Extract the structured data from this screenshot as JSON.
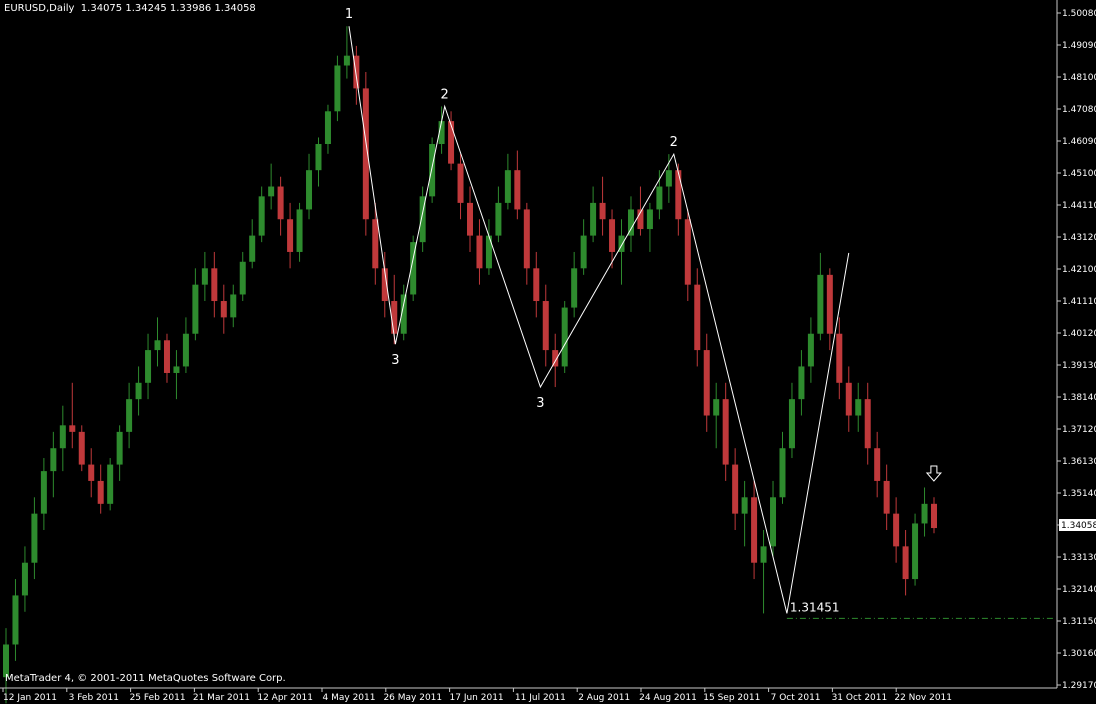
{
  "header": {
    "symbol": "EURUSD,Daily",
    "open": "1.34075",
    "high": "1.34245",
    "low": "1.33986",
    "close": "1.34058"
  },
  "copyright": "MetaTrader 4, © 2001-2011 MetaQuotes Software Corp.",
  "current_price": "1.34058",
  "colors": {
    "background": "#000000",
    "bull": "#2e8b2e",
    "bear": "#c0393b",
    "axis": "#c8c8c8",
    "grid_dash": "#2e8b2e",
    "price_tag_bg": "#ffffff",
    "price_tag_fg": "#000000"
  },
  "chart_data": {
    "type": "candlestick",
    "y_ticks": [
      "1.50080",
      "1.49090",
      "1.48100",
      "1.47080",
      "1.46090",
      "1.45100",
      "1.44110",
      "1.43120",
      "1.42100",
      "1.41110",
      "1.40120",
      "1.39130",
      "1.38140",
      "1.37120",
      "1.36130",
      "1.35140",
      "1.34058",
      "1.33130",
      "1.32140",
      "1.31150",
      "1.30160",
      "1.29170"
    ],
    "x_ticks": [
      "12 Jan 2011",
      "3 Feb 2011",
      "25 Feb 2011",
      "21 Mar 2011",
      "12 Apr 2011",
      "4 May 2011",
      "26 May 2011",
      "17 Jun 2011",
      "11 Jul 2011",
      "2 Aug 2011",
      "24 Aug 2011",
      "15 Sep 2011",
      "7 Oct 2011",
      "31 Oct 2011",
      "22 Nov 2011"
    ],
    "ylim": [
      1.2917,
      1.5008
    ],
    "zigzag": [
      {
        "date": "4 May 2011",
        "price": 1.494,
        "label": "1"
      },
      {
        "date": "20 May 2011",
        "price": 1.3968,
        "label": "3"
      },
      {
        "date": "6 Jun 2011",
        "price": 1.4695,
        "label": "2"
      },
      {
        "date": "11 Jul 2011",
        "price": 1.3837,
        "label": "3"
      },
      {
        "date": "26 Aug 2011",
        "price": 1.4549,
        "label": "2"
      },
      {
        "date": "4 Oct 2011",
        "price": 1.3145,
        "label": ""
      },
      {
        "date": "27 Oct 2011",
        "price": 1.4247,
        "label": ""
      }
    ],
    "low_marker": {
      "price": 1.31451,
      "label": "1.31451"
    },
    "arrow_marker": {
      "date": "25 Nov 2011",
      "direction": "down"
    },
    "candles_approx": [
      [
        1.295,
        1.31,
        1.287,
        1.305
      ],
      [
        1.305,
        1.325,
        1.3,
        1.32
      ],
      [
        1.32,
        1.335,
        1.315,
        1.33
      ],
      [
        1.33,
        1.35,
        1.325,
        1.345
      ],
      [
        1.345,
        1.362,
        1.34,
        1.358
      ],
      [
        1.358,
        1.37,
        1.35,
        1.365
      ],
      [
        1.365,
        1.378,
        1.358,
        1.372
      ],
      [
        1.372,
        1.385,
        1.365,
        1.37
      ],
      [
        1.37,
        1.372,
        1.358,
        1.36
      ],
      [
        1.36,
        1.365,
        1.35,
        1.355
      ],
      [
        1.355,
        1.36,
        1.345,
        1.348
      ],
      [
        1.348,
        1.362,
        1.346,
        1.36
      ],
      [
        1.36,
        1.372,
        1.355,
        1.37
      ],
      [
        1.37,
        1.385,
        1.365,
        1.38
      ],
      [
        1.38,
        1.39,
        1.375,
        1.385
      ],
      [
        1.385,
        1.4,
        1.38,
        1.395
      ],
      [
        1.395,
        1.405,
        1.39,
        1.398
      ],
      [
        1.398,
        1.4,
        1.385,
        1.388
      ],
      [
        1.388,
        1.395,
        1.38,
        1.39
      ],
      [
        1.39,
        1.405,
        1.388,
        1.4
      ],
      [
        1.4,
        1.42,
        1.398,
        1.415
      ],
      [
        1.415,
        1.425,
        1.41,
        1.42
      ],
      [
        1.42,
        1.425,
        1.405,
        1.41
      ],
      [
        1.41,
        1.415,
        1.4,
        1.405
      ],
      [
        1.405,
        1.415,
        1.402,
        1.412
      ],
      [
        1.412,
        1.425,
        1.41,
        1.422
      ],
      [
        1.422,
        1.435,
        1.42,
        1.43
      ],
      [
        1.43,
        1.445,
        1.428,
        1.442
      ],
      [
        1.442,
        1.452,
        1.438,
        1.445
      ],
      [
        1.445,
        1.448,
        1.43,
        1.435
      ],
      [
        1.435,
        1.44,
        1.42,
        1.425
      ],
      [
        1.425,
        1.44,
        1.422,
        1.438
      ],
      [
        1.438,
        1.455,
        1.435,
        1.45
      ],
      [
        1.45,
        1.46,
        1.445,
        1.458
      ],
      [
        1.458,
        1.47,
        1.455,
        1.468
      ],
      [
        1.468,
        1.485,
        1.465,
        1.482
      ],
      [
        1.482,
        1.494,
        1.478,
        1.485
      ],
      [
        1.485,
        1.488,
        1.47,
        1.475
      ],
      [
        1.475,
        1.48,
        1.43,
        1.435
      ],
      [
        1.435,
        1.44,
        1.415,
        1.42
      ],
      [
        1.42,
        1.425,
        1.405,
        1.41
      ],
      [
        1.41,
        1.418,
        1.3968,
        1.4
      ],
      [
        1.4,
        1.415,
        1.398,
        1.412
      ],
      [
        1.412,
        1.43,
        1.41,
        1.428
      ],
      [
        1.428,
        1.445,
        1.425,
        1.442
      ],
      [
        1.442,
        1.46,
        1.44,
        1.458
      ],
      [
        1.458,
        1.4695,
        1.455,
        1.465
      ],
      [
        1.465,
        1.468,
        1.45,
        1.452
      ],
      [
        1.452,
        1.455,
        1.435,
        1.44
      ],
      [
        1.44,
        1.445,
        1.425,
        1.43
      ],
      [
        1.43,
        1.435,
        1.415,
        1.42
      ],
      [
        1.42,
        1.435,
        1.418,
        1.43
      ],
      [
        1.43,
        1.445,
        1.428,
        1.44
      ],
      [
        1.44,
        1.455,
        1.438,
        1.45
      ],
      [
        1.45,
        1.456,
        1.435,
        1.438
      ],
      [
        1.438,
        1.44,
        1.415,
        1.42
      ],
      [
        1.42,
        1.425,
        1.405,
        1.41
      ],
      [
        1.41,
        1.415,
        1.39,
        1.395
      ],
      [
        1.395,
        1.4,
        1.3837,
        1.39
      ],
      [
        1.39,
        1.41,
        1.388,
        1.408
      ],
      [
        1.408,
        1.425,
        1.405,
        1.42
      ],
      [
        1.42,
        1.435,
        1.418,
        1.43
      ],
      [
        1.43,
        1.445,
        1.428,
        1.44
      ],
      [
        1.44,
        1.448,
        1.43,
        1.435
      ],
      [
        1.435,
        1.438,
        1.42,
        1.425
      ],
      [
        1.425,
        1.435,
        1.415,
        1.43
      ],
      [
        1.43,
        1.442,
        1.425,
        1.438
      ],
      [
        1.438,
        1.445,
        1.43,
        1.432
      ],
      [
        1.432,
        1.44,
        1.425,
        1.438
      ],
      [
        1.438,
        1.45,
        1.435,
        1.445
      ],
      [
        1.445,
        1.4549,
        1.44,
        1.45
      ],
      [
        1.45,
        1.452,
        1.43,
        1.435
      ],
      [
        1.435,
        1.438,
        1.41,
        1.415
      ],
      [
        1.415,
        1.42,
        1.39,
        1.395
      ],
      [
        1.395,
        1.4,
        1.37,
        1.375
      ],
      [
        1.375,
        1.385,
        1.365,
        1.38
      ],
      [
        1.38,
        1.385,
        1.355,
        1.36
      ],
      [
        1.36,
        1.365,
        1.34,
        1.345
      ],
      [
        1.345,
        1.355,
        1.335,
        1.35
      ],
      [
        1.35,
        1.355,
        1.325,
        1.33
      ],
      [
        1.33,
        1.34,
        1.3145,
        1.335
      ],
      [
        1.335,
        1.355,
        1.332,
        1.35
      ],
      [
        1.35,
        1.37,
        1.348,
        1.365
      ],
      [
        1.365,
        1.385,
        1.362,
        1.38
      ],
      [
        1.38,
        1.395,
        1.375,
        1.39
      ],
      [
        1.39,
        1.405,
        1.385,
        1.4
      ],
      [
        1.4,
        1.4247,
        1.398,
        1.418
      ],
      [
        1.418,
        1.42,
        1.395,
        1.4
      ],
      [
        1.4,
        1.405,
        1.38,
        1.385
      ],
      [
        1.385,
        1.39,
        1.37,
        1.375
      ],
      [
        1.375,
        1.385,
        1.37,
        1.38
      ],
      [
        1.38,
        1.385,
        1.36,
        1.365
      ],
      [
        1.365,
        1.37,
        1.35,
        1.355
      ],
      [
        1.355,
        1.36,
        1.34,
        1.345
      ],
      [
        1.345,
        1.35,
        1.33,
        1.335
      ],
      [
        1.335,
        1.34,
        1.32,
        1.325
      ],
      [
        1.325,
        1.345,
        1.323,
        1.342
      ],
      [
        1.342,
        1.353,
        1.338,
        1.348
      ],
      [
        1.348,
        1.35,
        1.339,
        1.3406
      ]
    ]
  }
}
